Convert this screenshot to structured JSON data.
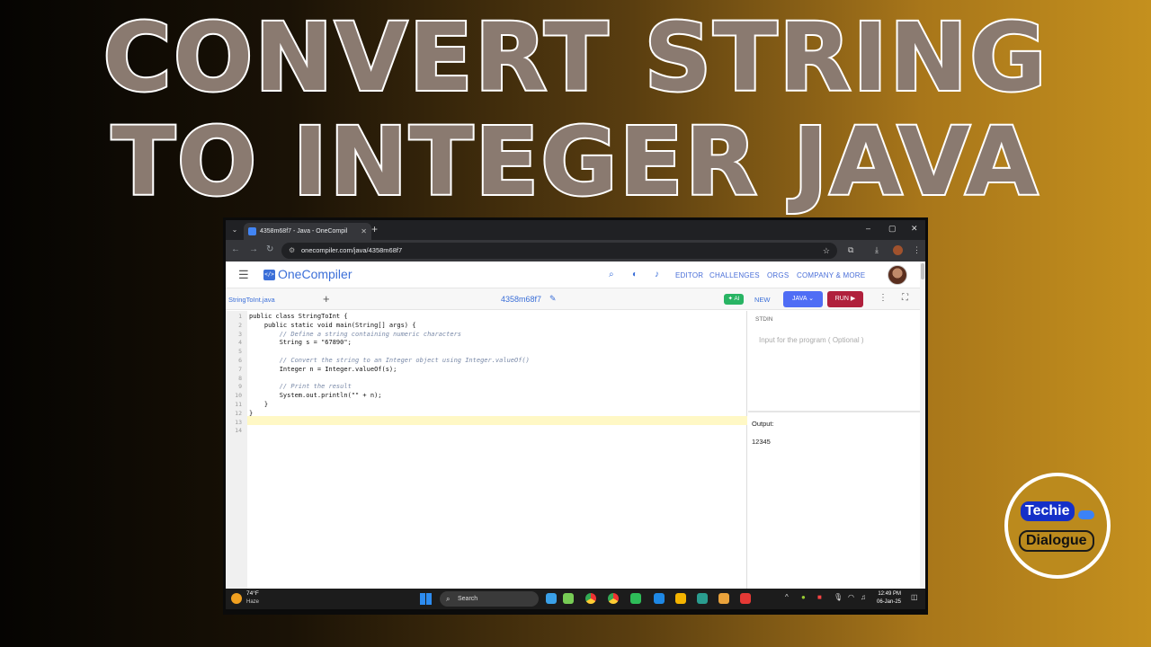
{
  "headline": {
    "line1": "CONVERT STRING",
    "line2": "TO INTEGER JAVA"
  },
  "browser": {
    "tab_title": "4358m68f7 - Java - OneCompil",
    "new_tab": "+",
    "window_controls": [
      "–",
      "▢",
      "✕"
    ],
    "url": "onecompiler.com/java/4358m68f7"
  },
  "site": {
    "logo_mark": "</>",
    "logo_text": "OneCompiler",
    "nav": [
      "EDITOR",
      "CHALLENGES",
      "ORGS",
      "COMPANY & MORE"
    ]
  },
  "toolbar": {
    "file_name": "StringToInt.java",
    "add_file": "+",
    "code_id": "4358m68f7",
    "ai_label": "✦ AI",
    "new_label": "NEW",
    "language_label": "JAVA ⌄",
    "run_label": "RUN ▶"
  },
  "editor": {
    "line_numbers": [
      "1",
      "2",
      "3",
      "4",
      "5",
      "6",
      "7",
      "8",
      "9",
      "10",
      "11",
      "12",
      "13",
      "14"
    ],
    "lines": [
      "public class StringToInt {",
      "    public static void main(String[] args) {",
      "        // Define a string containing numeric characters",
      "        String s = \"67890\";",
      "",
      "        // Convert the string to an Integer object using Integer.valueOf()",
      "        Integer n = Integer.valueOf(s);",
      "",
      "        // Print the result",
      "        System.out.println(\"\" + n);",
      "    }",
      "}",
      "",
      ""
    ]
  },
  "stdin": {
    "label": "STDIN",
    "placeholder": "Input for the program ( Optional )"
  },
  "output": {
    "label": "Output:",
    "value": "12345"
  },
  "taskbar": {
    "temperature": "74°F",
    "condition": "Haze",
    "search": "Search",
    "time": "12:49 PM",
    "date": "06-Jan-25"
  },
  "badge": {
    "line1": "Techie",
    "line2": "Dialogue"
  },
  "colors": {
    "run": "#b0203c",
    "language": "#4f6df5",
    "brand": "#3b6fd8",
    "ai": "#28b463"
  }
}
